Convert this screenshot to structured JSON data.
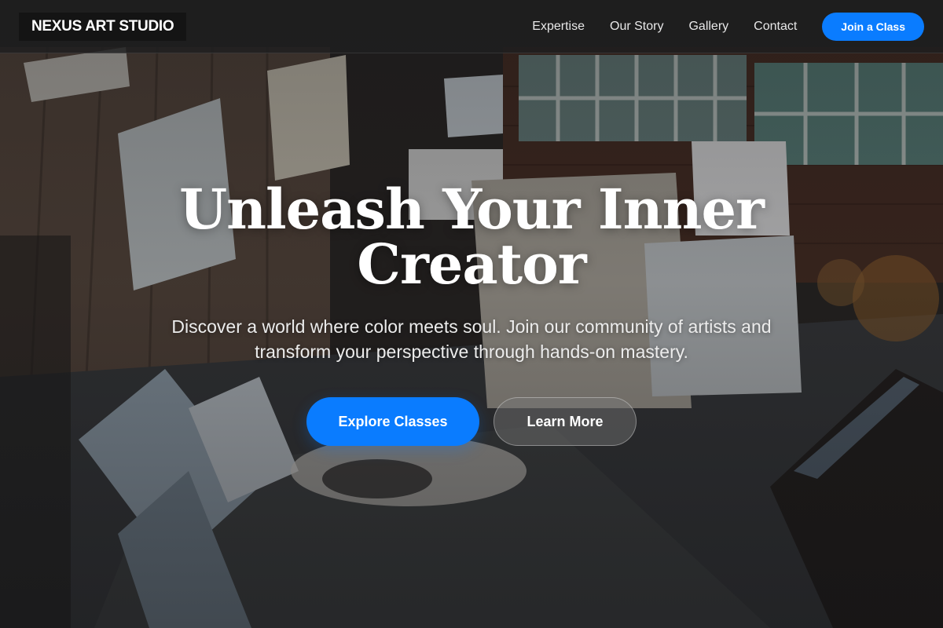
{
  "brand": {
    "name": "NEXUS ART STUDIO"
  },
  "nav": {
    "links": [
      {
        "label": "Expertise"
      },
      {
        "label": "Our Story"
      },
      {
        "label": "Gallery"
      },
      {
        "label": "Contact"
      }
    ],
    "cta_label": "Join a Class"
  },
  "hero": {
    "title": "Unleash Your Inner Creator",
    "subtitle": "Discover a world where color meets soul. Join our community of artists and transform your perspective through hands-on mastery.",
    "primary_button": "Explore Classes",
    "secondary_button": "Learn More"
  },
  "colors": {
    "accent": "#0a7cff",
    "navbar_bg": "#1e1e20",
    "brand_bg": "#141414"
  },
  "background": {
    "description_icon": "art-studio-photo"
  }
}
